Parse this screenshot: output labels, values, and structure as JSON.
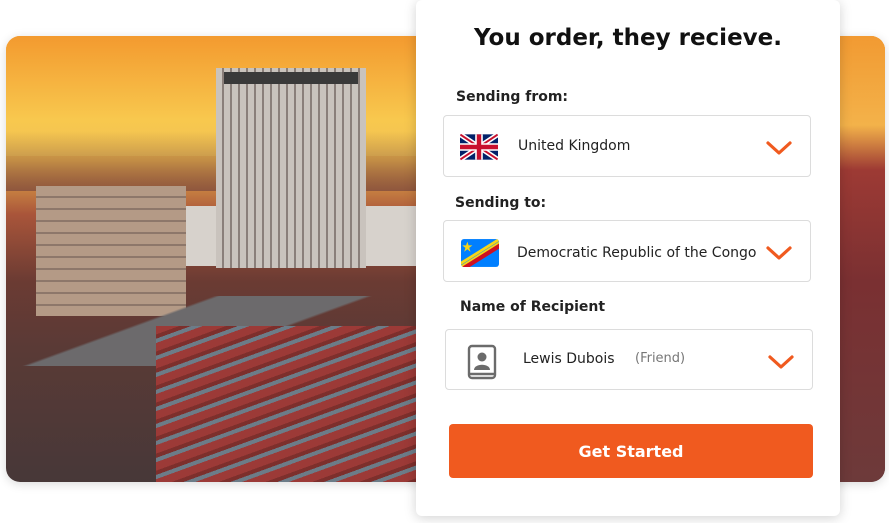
{
  "hero": {
    "title": "You order, they recieve."
  },
  "form": {
    "sending_from": {
      "label": "Sending from:",
      "value": "United Kingdom",
      "flag_icon": "uk-flag-icon"
    },
    "sending_to": {
      "label": "Sending to:",
      "value": "Democratic Republic of the Congo",
      "flag_icon": "drc-flag-icon"
    },
    "recipient": {
      "label": "Name of Recipient",
      "value": "Lewis Dubois",
      "relation": "(Friend)",
      "icon": "contact-book-icon"
    },
    "submit_label": "Get Started"
  },
  "colors": {
    "accent": "#f05a1f",
    "chevron": "#f05a1f",
    "text": "#222222"
  }
}
